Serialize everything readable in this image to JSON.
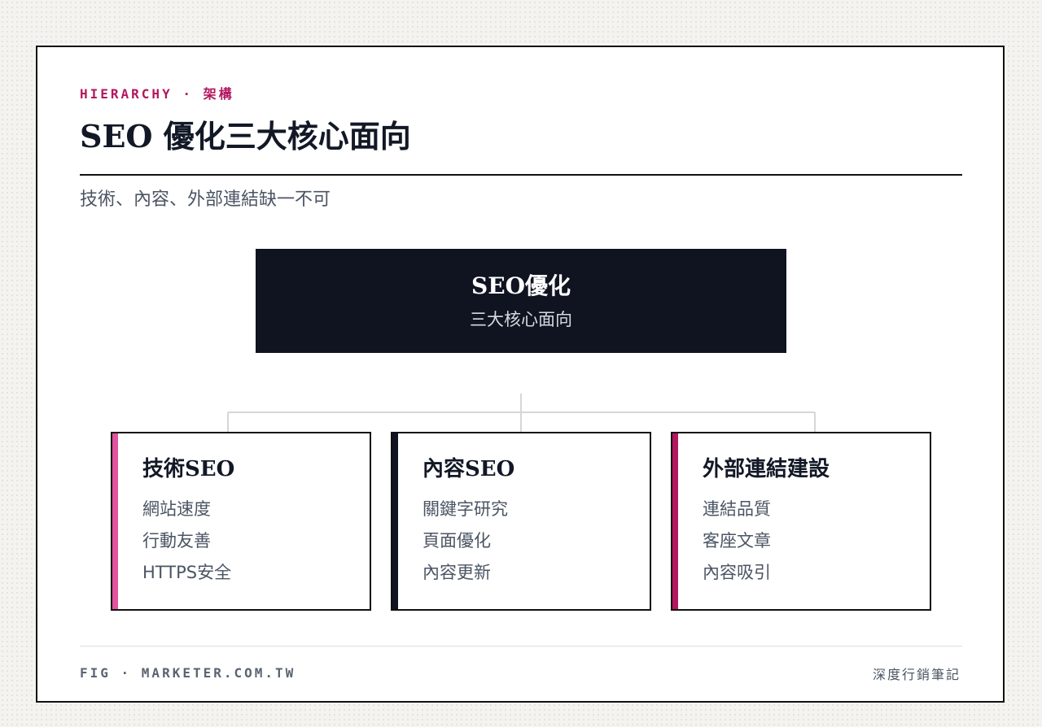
{
  "header": {
    "eyebrow": "HIERARCHY · 架構",
    "title": "SEO 優化三大核心面向",
    "subtitle": "技術、內容、外部連結缺一不可"
  },
  "diagram": {
    "root": {
      "title": "SEO優化",
      "subtitle": "三大核心面向"
    },
    "children": [
      {
        "title": "技術SEO",
        "items": [
          "網站速度",
          "行動友善",
          "HTTPS安全"
        ],
        "accent": "#e0539f"
      },
      {
        "title": "內容SEO",
        "items": [
          "關鍵字研究",
          "頁面優化",
          "內容更新"
        ],
        "accent": "#0f1420"
      },
      {
        "title": "外部連結建設",
        "items": [
          "連結品質",
          "客座文章",
          "內容吸引"
        ],
        "accent": "#b3175f"
      }
    ]
  },
  "footer": {
    "left": "FIG · MARKETER.COM.TW",
    "right": "深度行銷筆記"
  },
  "colors": {
    "brand": "#b3175f",
    "ink": "#121826",
    "muted": "#4b5563",
    "connector": "#d6d6d6"
  }
}
